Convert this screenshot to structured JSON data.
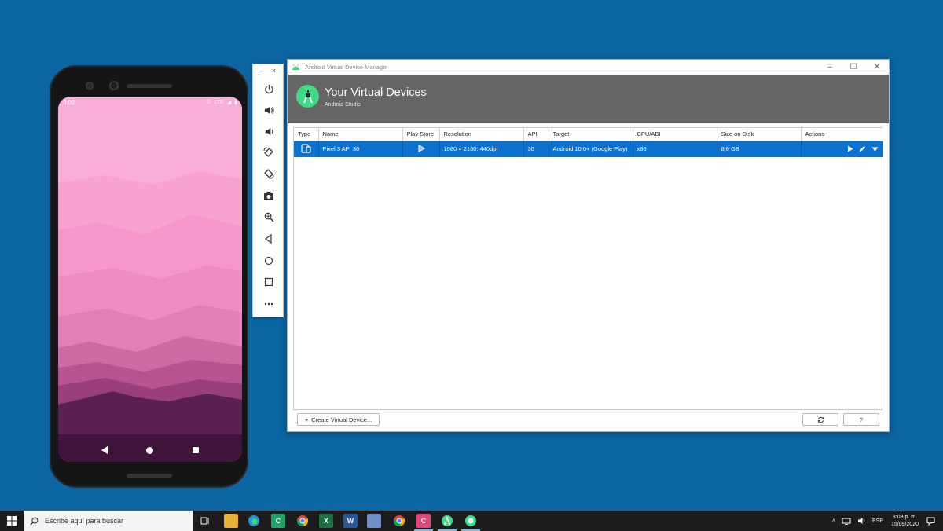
{
  "phone": {
    "time": "3:02",
    "network": "LTE"
  },
  "emulator_toolbar": {
    "minimize": "–",
    "close": "×",
    "tools": [
      "power-icon",
      "volume-up-icon",
      "volume-down-icon",
      "rotate-left-icon",
      "rotate-right-icon",
      "camera-icon",
      "zoom-icon",
      "back-icon",
      "home-icon",
      "overview-icon",
      "more-icon"
    ]
  },
  "avd_window": {
    "title": "Android Virtual Device Manager",
    "header_title": "Your Virtual Devices",
    "header_subtitle": "Android Studio",
    "columns": [
      "Type",
      "Name",
      "Play Store",
      "Resolution",
      "API",
      "Target",
      "CPU/ABI",
      "Size on Disk",
      "Actions"
    ],
    "rows": [
      {
        "name": "Pixel 3 API 30",
        "resolution": "1080 × 2160: 440dpi",
        "api": "30",
        "target": "Android 10.0+ (Google Play)",
        "cpu": "x86",
        "size": "8,6 GB"
      }
    ],
    "create_button": "Create Virtual Device...",
    "help_button": "?"
  },
  "taskbar": {
    "search_placeholder": "Escribe aquí para buscar",
    "language": "ESP",
    "time": "3:03 p. m.",
    "date": "15/09/2020"
  },
  "colors": {
    "desktop": "#0c66a3",
    "selection": "#0d72cf",
    "android_green": "#3ddc84",
    "header_gray": "#656565"
  }
}
